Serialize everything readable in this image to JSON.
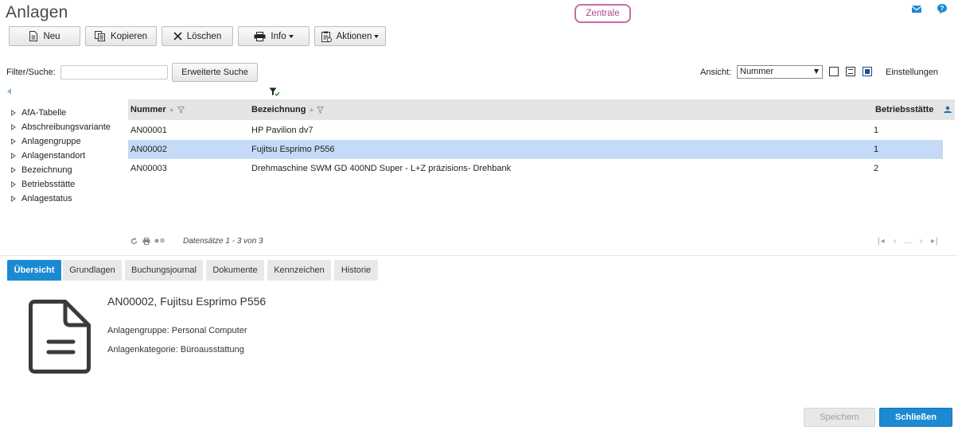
{
  "app": {
    "title": "Anlagen",
    "tenant": "Zentrale"
  },
  "toolbar": {
    "new_label": "Neu",
    "copy_label": "Kopieren",
    "delete_label": "Löschen",
    "info_label": "Info",
    "actions_label": "Aktionen"
  },
  "filter": {
    "label": "Filter/Suche:",
    "value": "",
    "extended_search_label": "Erweiterte Suche"
  },
  "view": {
    "label": "Ansicht:",
    "selected": "Nummer",
    "settings_label": "Einstellungen"
  },
  "tree": {
    "items": [
      {
        "label": "AfA-Tabelle"
      },
      {
        "label": "Abschreibungsvariante"
      },
      {
        "label": "Anlagengruppe"
      },
      {
        "label": "Anlagenstandort"
      },
      {
        "label": "Bezeichnung"
      },
      {
        "label": "Betriebsstätte"
      },
      {
        "label": "Anlagestatus"
      }
    ]
  },
  "grid": {
    "columns": {
      "number": "Nummer",
      "description": "Bezeichnung",
      "site": "Betriebsstätte"
    },
    "rows": [
      {
        "number": "AN00001",
        "description": "HP Pavilion dv7",
        "site": "1",
        "selected": false
      },
      {
        "number": "AN00002",
        "description": "Fujitsu Esprimo P556",
        "site": "1",
        "selected": true
      },
      {
        "number": "AN00003",
        "description": "Drehmaschine SWM GD 400ND Super - L+Z präzisions- Drehbank",
        "site": "2",
        "selected": false
      }
    ],
    "pager_info": "Datensätze 1 - 3 von 3",
    "pager_ellipsis": "..."
  },
  "tabs": [
    {
      "label": "Übersicht",
      "active": true
    },
    {
      "label": "Grundlagen",
      "active": false
    },
    {
      "label": "Buchungsjournal",
      "active": false
    },
    {
      "label": "Dokumente",
      "active": false
    },
    {
      "label": "Kennzeichen",
      "active": false
    },
    {
      "label": "Historie",
      "active": false
    }
  ],
  "detail": {
    "title": "AN00002, Fujitsu Esprimo P556",
    "group_line": "Anlagengruppe: Personal Computer",
    "category_line": "Anlagenkategorie: Büroausstattung",
    "icon": "document-icon"
  },
  "footer": {
    "save_label": "Speichern",
    "close_label": "Schließen"
  },
  "colors": {
    "accent": "#1b8ad3",
    "selected_row": "#c5daf6",
    "tenant_border": "#c86aa8"
  }
}
